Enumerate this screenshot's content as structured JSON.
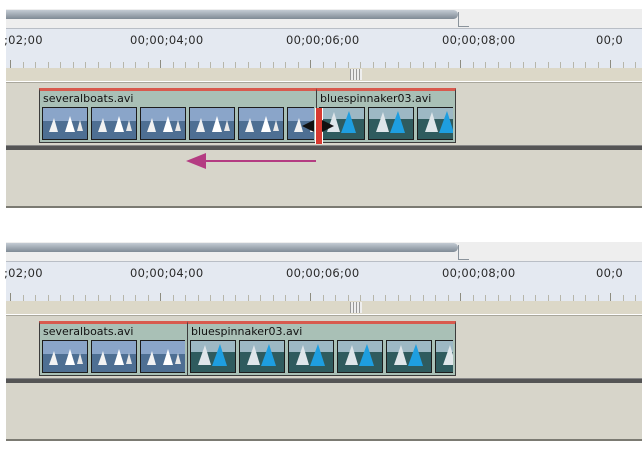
{
  "panels": [
    {
      "id": "before",
      "ruler": {
        "labels": [
          ";02;00",
          "00;00;04;00",
          "00;00;06;00",
          "00;00;08;00",
          "00;0"
        ]
      },
      "clips": [
        {
          "name": "severalboats.avi",
          "thumbnails": 6
        },
        {
          "name": "bluespinnaker03.avi",
          "thumbnails": 3
        }
      ],
      "drag_direction": "left"
    },
    {
      "id": "after",
      "ruler": {
        "labels": [
          ";02;00",
          "00;00;04;00",
          "00;00;06;00",
          "00;00;08;00",
          "00;0"
        ]
      },
      "clips": [
        {
          "name": "severalboats.avi",
          "thumbnails": 3
        },
        {
          "name": "bluespinnaker03.avi",
          "thumbnails": 6
        }
      ]
    }
  ],
  "colors": {
    "clip_fill": "#a9c0b6",
    "clip_top_edge": "#d85a4e",
    "drag_arrow": "#b43c82",
    "ruler_bg": "#e4e9f1",
    "track_bg": "#d7d5ca"
  },
  "icons": [
    "rolling-edit-cursor-icon",
    "drag-left-arrow-icon"
  ]
}
